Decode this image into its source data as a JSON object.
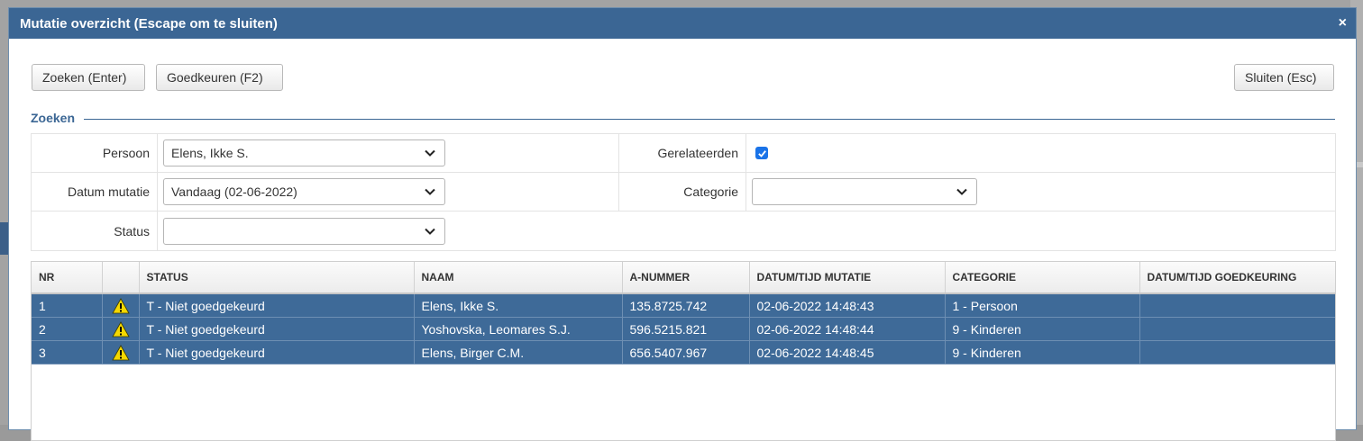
{
  "modal": {
    "title": "Mutatie overzicht (Escape om te sluiten)",
    "close_glyph": "×"
  },
  "toolbar": {
    "search_label": "Zoeken (Enter)",
    "approve_label": "Goedkeuren (F2)",
    "close_label": "Sluiten (Esc)"
  },
  "search_section": {
    "legend": "Zoeken",
    "persoon_label": "Persoon",
    "persoon_value": "Elens, Ikke S.",
    "gerelateerden_label": "Gerelateerden",
    "gerelateerden_checked": true,
    "datum_label": "Datum mutatie",
    "datum_value": "Vandaag (02-06-2022)",
    "categorie_label": "Categorie",
    "categorie_value": "",
    "status_label": "Status",
    "status_value": ""
  },
  "grid": {
    "columns": [
      "NR",
      "",
      "STATUS",
      "NAAM",
      "A-NUMMER",
      "DATUM/TIJD MUTATIE",
      "CATEGORIE",
      "DATUM/TIJD GOEDKEURING"
    ],
    "rows": [
      {
        "nr": "1",
        "icon": "warning-icon",
        "status": "T - Niet goedgekeurd",
        "naam": "Elens, Ikke S.",
        "anummer": "135.8725.742",
        "datum": "02-06-2022 14:48:43",
        "categorie": "1 - Persoon",
        "goedkeuring": ""
      },
      {
        "nr": "2",
        "icon": "warning-icon",
        "status": "T - Niet goedgekeurd",
        "naam": "Yoshovska, Leomares S.J.",
        "anummer": "596.5215.821",
        "datum": "02-06-2022 14:48:44",
        "categorie": "9 - Kinderen",
        "goedkeuring": ""
      },
      {
        "nr": "3",
        "icon": "warning-icon",
        "status": "T - Niet goedgekeurd",
        "naam": "Elens, Birger C.M.",
        "anummer": "656.5407.967",
        "datum": "02-06-2022 14:48:45",
        "categorie": "9 - Kinderen",
        "goedkeuring": ""
      }
    ]
  },
  "colors": {
    "header_bg": "#3b6694",
    "selected_row_bg": "#3e6a98",
    "accent": "#3b6694",
    "checkbox": "#1a73e8",
    "warning": "#f5d800"
  }
}
